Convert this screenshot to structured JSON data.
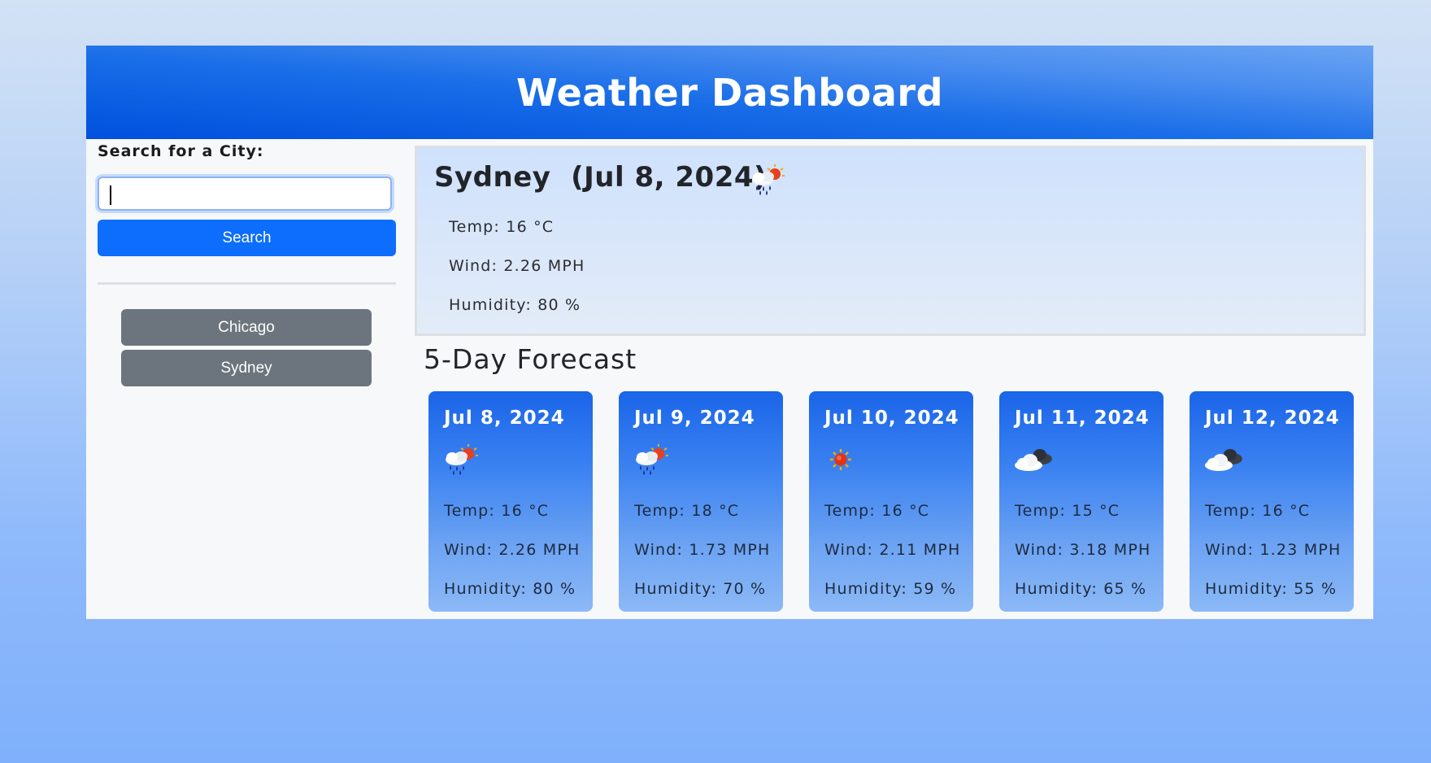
{
  "header": {
    "title": "Weather Dashboard"
  },
  "search": {
    "label": "Search for a City:",
    "value": "",
    "button_label": "Search"
  },
  "history": [
    {
      "label": "Chicago"
    },
    {
      "label": "Sydney"
    }
  ],
  "current": {
    "title": "Sydney  (Jul 8, 2024)",
    "icon": "rain-sun-icon",
    "temp": "Temp: 16 °C",
    "wind": "Wind: 2.26 MPH",
    "humidity": "Humidity: 80 %"
  },
  "forecast": {
    "heading": "5-Day Forecast",
    "days": [
      {
        "date": "Jul 8, 2024",
        "icon": "rain-sun-icon",
        "temp": "Temp: 16 °C",
        "wind": "Wind: 2.26 MPH",
        "humidity": "Humidity: 80 %"
      },
      {
        "date": "Jul 9, 2024",
        "icon": "rain-sun-icon",
        "temp": "Temp: 18 °C",
        "wind": "Wind: 1.73 MPH",
        "humidity": "Humidity: 70 %"
      },
      {
        "date": "Jul 10, 2024",
        "icon": "sun-icon",
        "temp": "Temp: 16 °C",
        "wind": "Wind: 2.11 MPH",
        "humidity": "Humidity: 59 %"
      },
      {
        "date": "Jul 11, 2024",
        "icon": "clouds-icon",
        "temp": "Temp: 15 °C",
        "wind": "Wind: 3.18 MPH",
        "humidity": "Humidity: 65 %"
      },
      {
        "date": "Jul 12, 2024",
        "icon": "clouds-icon",
        "temp": "Temp: 16 °C",
        "wind": "Wind: 1.23 MPH",
        "humidity": "Humidity: 55 %"
      }
    ]
  },
  "colors": {
    "header": "#1a6ee8",
    "primary_button": "#0d6efd",
    "history_button": "#6c757d",
    "card": "#3b82f1"
  }
}
